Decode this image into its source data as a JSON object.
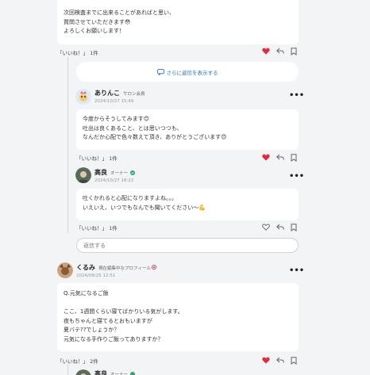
{
  "post1": {
    "body": "次回検査までに出来ることがあればと思い、\n質問させていただきます😳\nよろしくお願いします！",
    "likes_label": "「いいね！」 1件"
  },
  "thread": {
    "show_more_label": "さらに返信を表示する",
    "reply1": {
      "user": "ありんこ",
      "role": "サロン会員",
      "date": "2024/10/27 15:49",
      "body": "今度からそうしてみます😊\n吐出は良くあること、とは思いつつも、\nなんだか心配で色々数えて頂き、ありがとうございます😊",
      "likes_label": "「いいね！」 1件"
    },
    "reply2": {
      "user": "高良",
      "role": "オーナー",
      "date": "2024/10/27 18:22",
      "body": "吐くかれると心配になりますよね。。。\nいえいえ、いつでもなんでも聞いてください〜💪",
      "likes_label": "「いいね！」 1件"
    },
    "reply_input": {
      "placeholder": "返信する"
    }
  },
  "post2": {
    "user": "くるみ",
    "role": "現在編集中なプロフィール",
    "date": "2024/08/25 12:51",
    "body": "Q.元気になるご飯\n\nここ、1週間くらい寝てばかりいる気がします。\n夜もちゃんと寝てるとおもいますが\n夏バテ??でしょうか？\n元気になる手作りご飯ってありますか？",
    "likes_label": "「いいね！」 2件"
  },
  "next_reply": {
    "user": "高良",
    "role": "オーナー"
  },
  "colors": {
    "heart": "#e8283c",
    "link": "#2a6fdb",
    "owner_badge": "#2aa56b"
  },
  "icons": [
    "heart-icon",
    "heart-outline-icon",
    "reply-icon",
    "bookmark-icon",
    "more-icon",
    "chat-icon"
  ]
}
